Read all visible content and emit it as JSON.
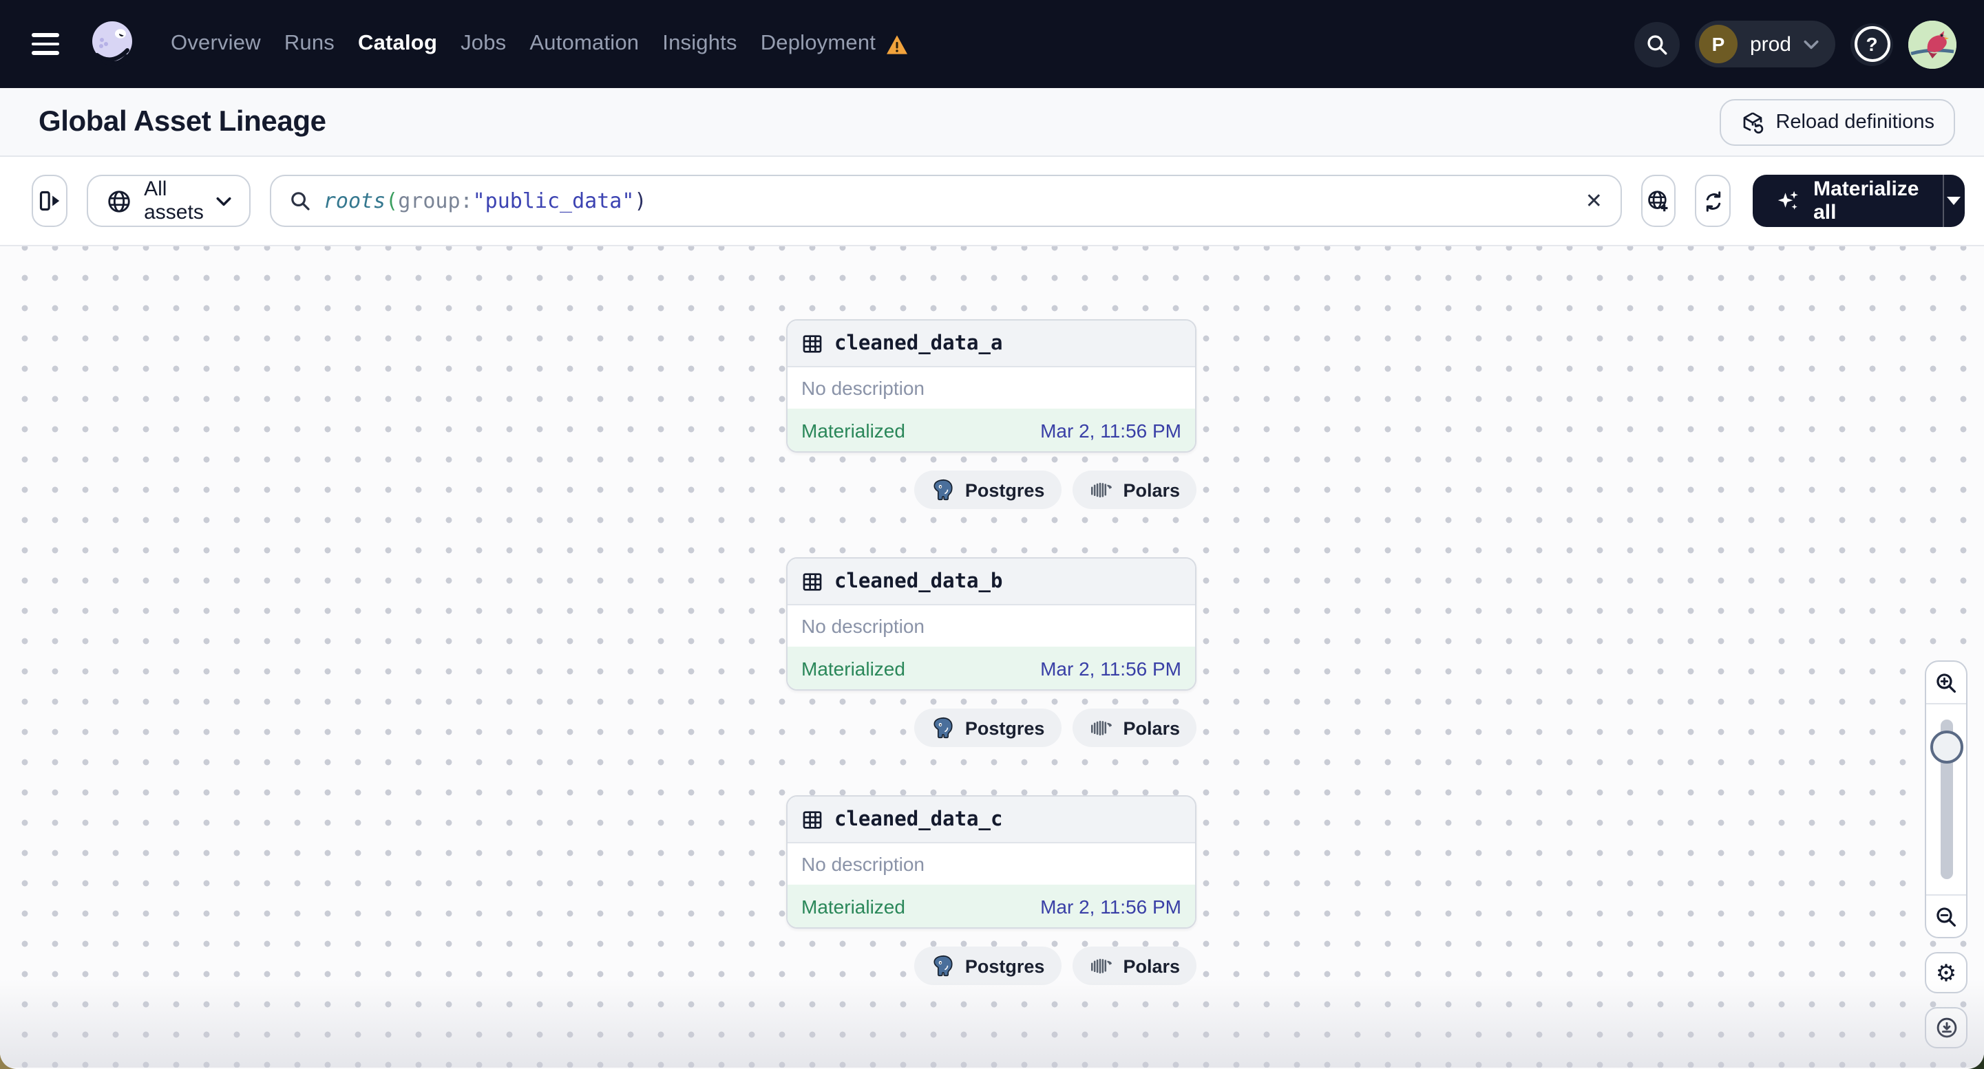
{
  "nav": {
    "items": [
      {
        "label": "Overview"
      },
      {
        "label": "Runs"
      },
      {
        "label": "Catalog"
      },
      {
        "label": "Jobs"
      },
      {
        "label": "Automation"
      },
      {
        "label": "Insights"
      },
      {
        "label": "Deployment"
      }
    ],
    "active_item": "Catalog",
    "workspace": {
      "initial": "P",
      "name": "prod"
    },
    "help_glyph": "?"
  },
  "header": {
    "title": "Global Asset Lineage",
    "reload_button": "Reload definitions"
  },
  "toolbar": {
    "asset_filter": "All assets",
    "query": {
      "func": "roots",
      "open_paren": "(",
      "attribute": "group:",
      "value": "\"public_data\"",
      "close_paren": ")"
    },
    "clear_glyph": "✕",
    "materialize_button": "Materialize all"
  },
  "graph": {
    "nodes": [
      {
        "name": "cleaned_data_a",
        "description": "No description",
        "status": "Materialized",
        "timestamp": "Mar 2, 11:56 PM",
        "tags": [
          {
            "label": "Postgres"
          },
          {
            "label": "Polars"
          }
        ]
      },
      {
        "name": "cleaned_data_b",
        "description": "No description",
        "status": "Materialized",
        "timestamp": "Mar 2, 11:56 PM",
        "tags": [
          {
            "label": "Postgres"
          },
          {
            "label": "Polars"
          }
        ]
      },
      {
        "name": "cleaned_data_c",
        "description": "No description",
        "status": "Materialized",
        "timestamp": "Mar 2, 11:56 PM",
        "tags": [
          {
            "label": "Postgres"
          },
          {
            "label": "Polars"
          }
        ]
      }
    ]
  },
  "controls": {
    "gear_glyph": "⚙"
  },
  "colors": {
    "nav_bg": "#0d1120",
    "button_dark": "#11162a",
    "brand_lavender": "#d8d5f4",
    "status_green_text": "#2a8759",
    "status_green_bg": "#e9f6ee",
    "timestamp_blue": "#393fa6",
    "warning_orange": "#f2a33c",
    "postgres_blue": "#4a6f9b"
  }
}
